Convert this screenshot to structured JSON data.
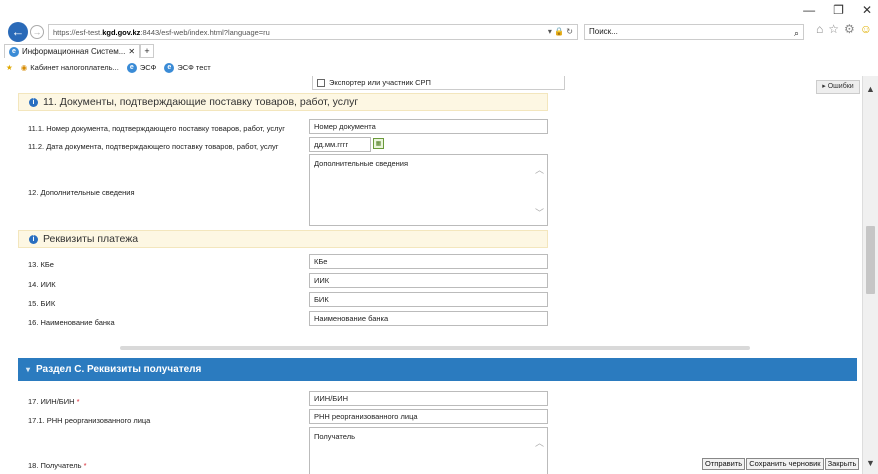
{
  "browser": {
    "url_prefix": "https://esf-test.",
    "url_domain": "kgd.gov.kz",
    "url_rest": ":8443/esf-web/index.html?language=ru",
    "search_placeholder": "Поиск...",
    "tab_title": "Информационная Систем...",
    "favorites": [
      "Кабинет налогоплатель...",
      "ЭСФ",
      "ЭСФ тест"
    ],
    "win_minimize": "—",
    "win_restore": "❐",
    "win_close": "✕"
  },
  "form": {
    "exporter_checkbox_label": "Экспортер или участник СРП",
    "section11_title": "11. Документы, подтверждающие поставку товаров, работ, услуг",
    "doc_number_label": "11.1. Номер документа, подтверждающего поставку товаров, работ, услуг",
    "doc_number_placeholder": "Номер документа",
    "doc_date_label": "11.2. Дата документа, подтверждающего поставку товаров, работ, услуг",
    "doc_date_placeholder": "дд.мм.гггг",
    "additional_label": "12. Дополнительные сведения",
    "additional_placeholder": "Дополнительные сведения",
    "payment_title": "Реквизиты платежа",
    "kbe_label": "13. КБе",
    "kbe_placeholder": "КБе",
    "iik_label": "14. ИИК",
    "iik_placeholder": "ИИК",
    "bik_label": "15. БИК",
    "bik_placeholder": "БИК",
    "bank_label": "16. Наименование банка",
    "bank_placeholder": "Наименование банка",
    "section_c_title": "Раздел С. Реквизиты получателя",
    "iin_label": "17. ИИН/БИН",
    "iin_placeholder": "ИИН/БИН",
    "rnn_label": "17.1. РНН реорганизованного лица",
    "rnn_placeholder": "РНН реорганизованного лица",
    "recipient_label": "18. Получатель",
    "recipient_placeholder": "Получатель",
    "required_mark": "*"
  },
  "errors_tab": "▸ Ошибки",
  "actions": {
    "send": "Отправить",
    "save_draft": "Сохранить черновик",
    "close": "Закрыть"
  },
  "colors": {
    "section_header_bg": "#2b7bbf",
    "info_header_bg": "#fdf7e3",
    "required": "#d9232e"
  }
}
